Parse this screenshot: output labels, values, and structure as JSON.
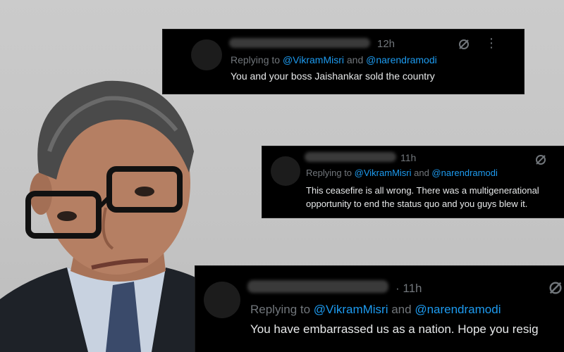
{
  "tweets": [
    {
      "time": "12h",
      "reply_prefix": "Replying to ",
      "mention1": "@VikramMisri",
      "and": " and ",
      "mention2": "@narendramodi",
      "text": "You and your boss Jaishankar sold the country"
    },
    {
      "time": "11h",
      "reply_prefix": "Replying to ",
      "mention1": "@VikramMisri",
      "and": " and ",
      "mention2": "@narendramodi",
      "text_line1": "This ceasefire is all wrong. There was a multigenerational",
      "text_line2": "opportunity to end the status quo and you guys blew it."
    },
    {
      "time": "· 11h",
      "reply_prefix": "Replying to ",
      "mention1": "@VikramMisri",
      "and": " and ",
      "mention2": "@narendramodi",
      "text": "You have embarrassed us as a nation. Hope you resig"
    }
  ],
  "icons": {
    "grok": "grok-icon",
    "more": "more-icon"
  },
  "colors": {
    "card_bg": "#000000",
    "text": "#e7e9ea",
    "muted": "#71767b",
    "mention": "#1d9bf0",
    "background": "#c9c9c9"
  }
}
